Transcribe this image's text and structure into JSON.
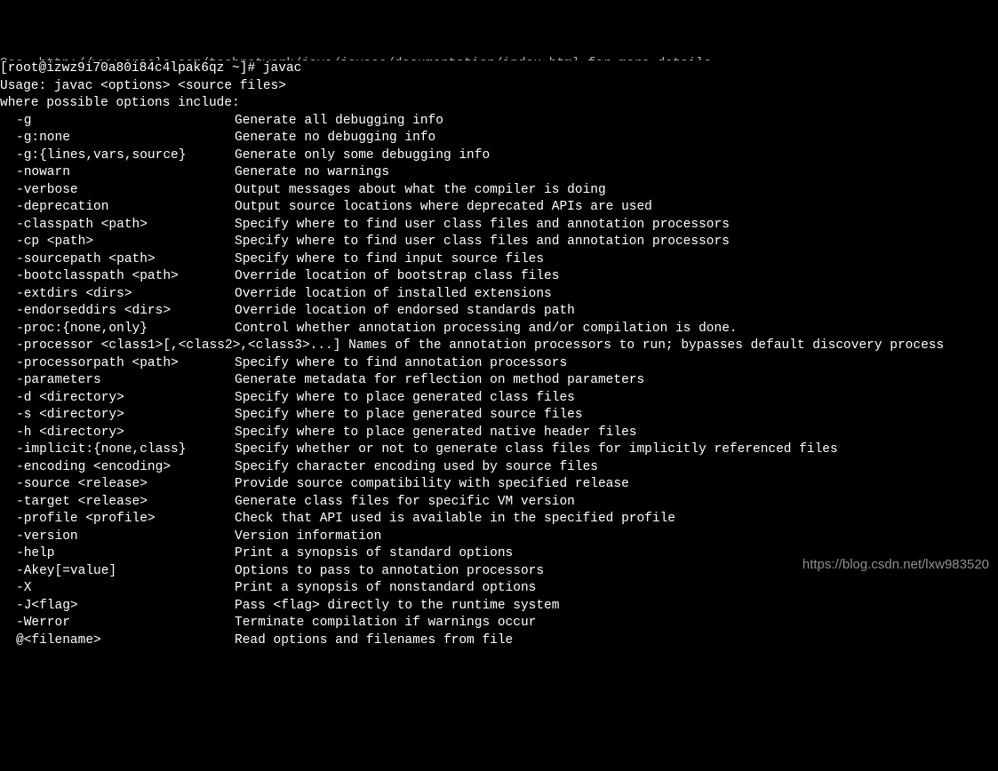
{
  "header_cut": "See  http://www.oracle.com/technetwork/java/javase/documentation/index.html for more details.",
  "prompt_line": "[root@izwz9i70a80i84c4lpak6qz ~]# javac",
  "usage_line": "Usage: javac <options> <source files>",
  "where_line": "where possible options include:",
  "options": [
    {
      "flag": "-g",
      "desc": "Generate all debugging info"
    },
    {
      "flag": "-g:none",
      "desc": "Generate no debugging info"
    },
    {
      "flag": "-g:{lines,vars,source}",
      "desc": "Generate only some debugging info"
    },
    {
      "flag": "-nowarn",
      "desc": "Generate no warnings"
    },
    {
      "flag": "-verbose",
      "desc": "Output messages about what the compiler is doing"
    },
    {
      "flag": "-deprecation",
      "desc": "Output source locations where deprecated APIs are used"
    },
    {
      "flag": "-classpath <path>",
      "desc": "Specify where to find user class files and annotation processors"
    },
    {
      "flag": "-cp <path>",
      "desc": "Specify where to find user class files and annotation processors"
    },
    {
      "flag": "-sourcepath <path>",
      "desc": "Specify where to find input source files"
    },
    {
      "flag": "-bootclasspath <path>",
      "desc": "Override location of bootstrap class files"
    },
    {
      "flag": "-extdirs <dirs>",
      "desc": "Override location of installed extensions"
    },
    {
      "flag": "-endorseddirs <dirs>",
      "desc": "Override location of endorsed standards path"
    },
    {
      "flag": "-proc:{none,only}",
      "desc": "Control whether annotation processing and/or compilation is done."
    },
    {
      "flag": "-processor <class1>[,<class2>,<class3>...] Names of the annotation processors to run; bypasses default discovery process",
      "full": true
    },
    {
      "flag": "-processorpath <path>",
      "desc": "Specify where to find annotation processors"
    },
    {
      "flag": "-parameters",
      "desc": "Generate metadata for reflection on method parameters"
    },
    {
      "flag": "-d <directory>",
      "desc": "Specify where to place generated class files"
    },
    {
      "flag": "-s <directory>",
      "desc": "Specify where to place generated source files"
    },
    {
      "flag": "-h <directory>",
      "desc": "Specify where to place generated native header files"
    },
    {
      "flag": "-implicit:{none,class}",
      "desc": "Specify whether or not to generate class files for implicitly referenced files"
    },
    {
      "flag": "-encoding <encoding>",
      "desc": "Specify character encoding used by source files"
    },
    {
      "flag": "-source <release>",
      "desc": "Provide source compatibility with specified release"
    },
    {
      "flag": "-target <release>",
      "desc": "Generate class files for specific VM version"
    },
    {
      "flag": "-profile <profile>",
      "desc": "Check that API used is available in the specified profile"
    },
    {
      "flag": "-version",
      "desc": "Version information"
    },
    {
      "flag": "-help",
      "desc": "Print a synopsis of standard options"
    },
    {
      "flag": "-Akey[=value]",
      "desc": "Options to pass to annotation processors"
    },
    {
      "flag": "-X",
      "desc": "Print a synopsis of nonstandard options"
    },
    {
      "flag": "-J<flag>",
      "desc": "Pass <flag> directly to the runtime system"
    },
    {
      "flag": "-Werror",
      "desc": "Terminate compilation if warnings occur"
    },
    {
      "flag": "@<filename>",
      "desc": "Read options and filenames from file"
    }
  ],
  "watermark": "https://blog.csdn.net/lxw983520"
}
